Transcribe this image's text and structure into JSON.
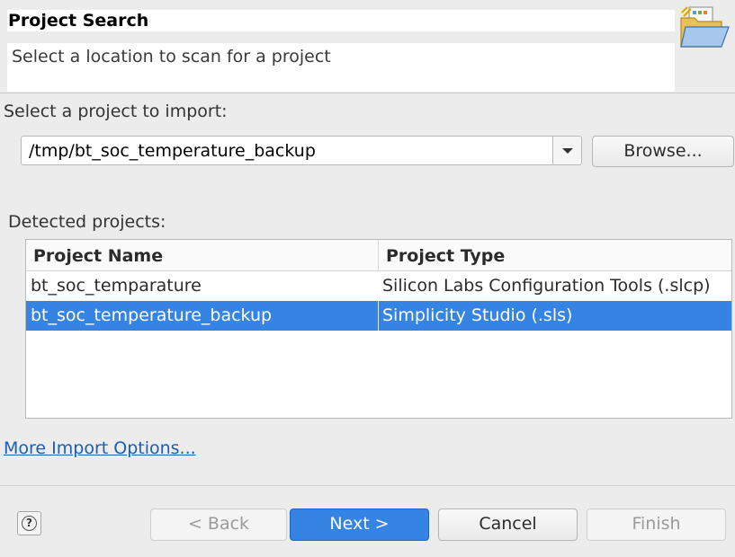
{
  "header": {
    "title": "Project Search",
    "description": "Select a location to scan for a project",
    "icon": "import-wizard-folder-icon"
  },
  "import": {
    "label": "Select a project to import:",
    "path_value": "/tmp/bt_soc_temperature_backup",
    "browse_label": "Browse..."
  },
  "projects": {
    "label": "Detected projects:",
    "columns": [
      "Project Name",
      "Project Type"
    ],
    "rows": [
      {
        "name": "bt_soc_temparature",
        "type": "Silicon Labs Configuration Tools (.slcp)",
        "selected": false
      },
      {
        "name": "bt_soc_temperature_backup",
        "type": "Simplicity Studio (.sls)",
        "selected": true
      }
    ]
  },
  "more_options_link": "More Import Options...",
  "footer": {
    "help_glyph": "?",
    "back_label": "< Back",
    "next_label": "Next >",
    "cancel_label": "Cancel",
    "finish_label": "Finish"
  },
  "colors": {
    "selection": "#3584e4",
    "link": "#1a5fb4"
  }
}
